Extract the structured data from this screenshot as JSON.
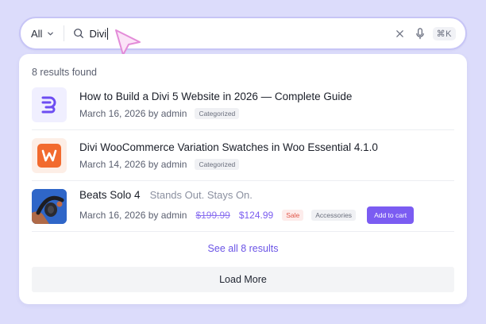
{
  "search": {
    "scope_label": "All",
    "query": "Divi",
    "shortcut": "⌘K"
  },
  "results": {
    "count_label": "8 results found",
    "items": [
      {
        "title": "How to Build a Divi 5 Website in 2026 — Complete Guide",
        "date": "March 16, 2026",
        "author_label": "by admin",
        "badge": "Categorized",
        "thumb_icon": "divi-logo-icon"
      },
      {
        "title": "Divi WooCommerce Variation Swatches in Woo Essential 4.1.0",
        "date": "March 14, 2026",
        "author_label": "by admin",
        "badge": "Categorized",
        "thumb_icon": "woo-essential-logo-icon"
      },
      {
        "title": "Beats Solo 4",
        "tagline": "Stands Out. Stays On.",
        "date": "March 16, 2026",
        "author_label": "by admin",
        "price_old": "$199.99",
        "price_new": "$124.99",
        "sale_badge": "Sale",
        "badge": "Accessories",
        "cart_label": "Add to cart",
        "thumb_icon": "headphones-product-image"
      }
    ],
    "see_all_label": "See all 8 results",
    "load_more_label": "Load More"
  },
  "colors": {
    "background": "#dcdcfb",
    "accent": "#7b5cf2",
    "link": "#6b54e6",
    "sale": "#e0564a",
    "cursor": "#e38bd8"
  }
}
